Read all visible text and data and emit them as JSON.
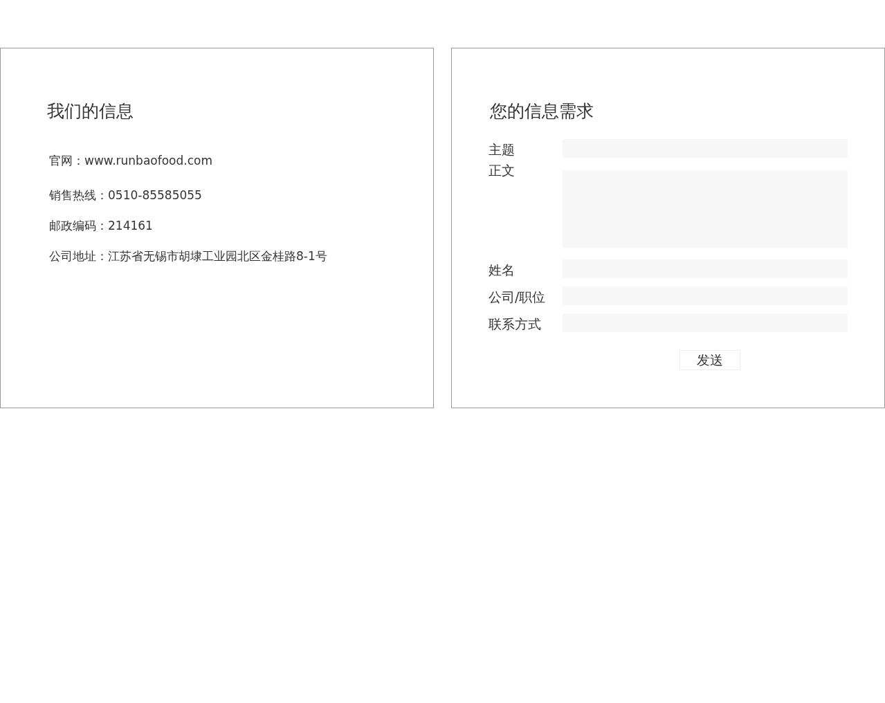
{
  "info_panel": {
    "title": "我们的信息",
    "lines": [
      "官网：www.runbaofood.com",
      "销售热线：0510-85585055",
      "邮政编码：214161",
      "公司地址：江苏省无锡市胡埭工业园北区金桂路8-1号"
    ]
  },
  "request_panel": {
    "title": "您的信息需求",
    "fields": [
      {
        "label": "主题",
        "kind": "input"
      },
      {
        "label": "正文",
        "kind": "textarea"
      },
      {
        "label": "姓名",
        "kind": "input"
      },
      {
        "label": "公司/职位",
        "kind": "input"
      },
      {
        "label": "联系方式",
        "kind": "input"
      }
    ],
    "submit": "发送"
  }
}
